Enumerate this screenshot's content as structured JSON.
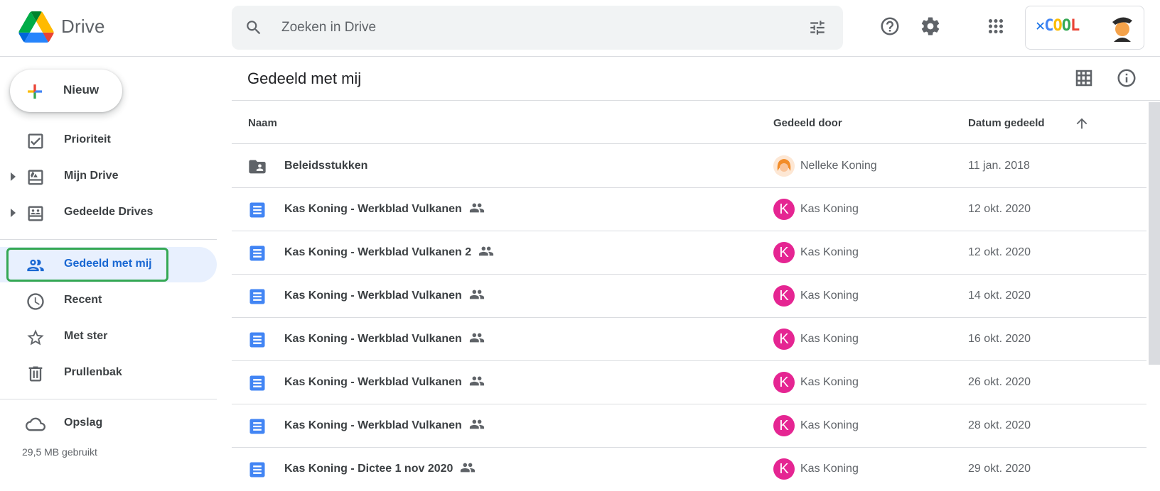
{
  "header": {
    "brand": "Drive",
    "search_placeholder": "Zoeken in Drive",
    "account_logo_text": "COOL"
  },
  "sidebar": {
    "new_label": "Nieuw",
    "items": [
      {
        "label": "Prioriteit",
        "icon": "priority-icon"
      },
      {
        "label": "Mijn Drive",
        "icon": "my-drive-icon"
      },
      {
        "label": "Gedeelde Drives",
        "icon": "shared-drives-icon"
      },
      {
        "label": "Gedeeld met mij",
        "icon": "shared-with-me-icon"
      },
      {
        "label": "Recent",
        "icon": "clock-icon"
      },
      {
        "label": "Met ster",
        "icon": "star-icon"
      },
      {
        "label": "Prullenbak",
        "icon": "trash-icon"
      },
      {
        "label": "Opslag",
        "icon": "cloud-icon"
      }
    ],
    "storage_used": "29,5 MB gebruikt"
  },
  "main": {
    "title": "Gedeeld met mij",
    "columns": {
      "name": "Naam",
      "shared_by": "Gedeeld door",
      "date": "Datum gedeeld"
    },
    "rows": [
      {
        "name": "Beleidsstukken",
        "type": "shared-folder",
        "shared": false,
        "owner": "Nelleke Koning",
        "owner_initial": "",
        "date": "11 jan. 2018"
      },
      {
        "name": "Kas Koning - Werkblad Vulkanen",
        "type": "doc",
        "shared": true,
        "owner": "Kas Koning",
        "owner_initial": "K",
        "date": "12 okt. 2020"
      },
      {
        "name": "Kas Koning - Werkblad Vulkanen 2",
        "type": "doc",
        "shared": true,
        "owner": "Kas Koning",
        "owner_initial": "K",
        "date": "12 okt. 2020"
      },
      {
        "name": "Kas Koning - Werkblad Vulkanen",
        "type": "doc",
        "shared": true,
        "owner": "Kas Koning",
        "owner_initial": "K",
        "date": "14 okt. 2020"
      },
      {
        "name": "Kas Koning - Werkblad Vulkanen",
        "type": "doc",
        "shared": true,
        "owner": "Kas Koning",
        "owner_initial": "K",
        "date": "16 okt. 2020"
      },
      {
        "name": "Kas Koning - Werkblad Vulkanen",
        "type": "doc",
        "shared": true,
        "owner": "Kas Koning",
        "owner_initial": "K",
        "date": "26 okt. 2020"
      },
      {
        "name": "Kas Koning - Werkblad Vulkanen",
        "type": "doc",
        "shared": true,
        "owner": "Kas Koning",
        "owner_initial": "K",
        "date": "28 okt. 2020"
      },
      {
        "name": "Kas Koning - Dictee 1 nov 2020",
        "type": "doc",
        "shared": true,
        "owner": "Kas Koning",
        "owner_initial": "K",
        "date": "29 okt. 2020"
      }
    ]
  },
  "colors": {
    "accent": "#1967d2",
    "active_bg": "#e8f0fe",
    "avatar": "#e52592",
    "highlight": "#34a853"
  }
}
